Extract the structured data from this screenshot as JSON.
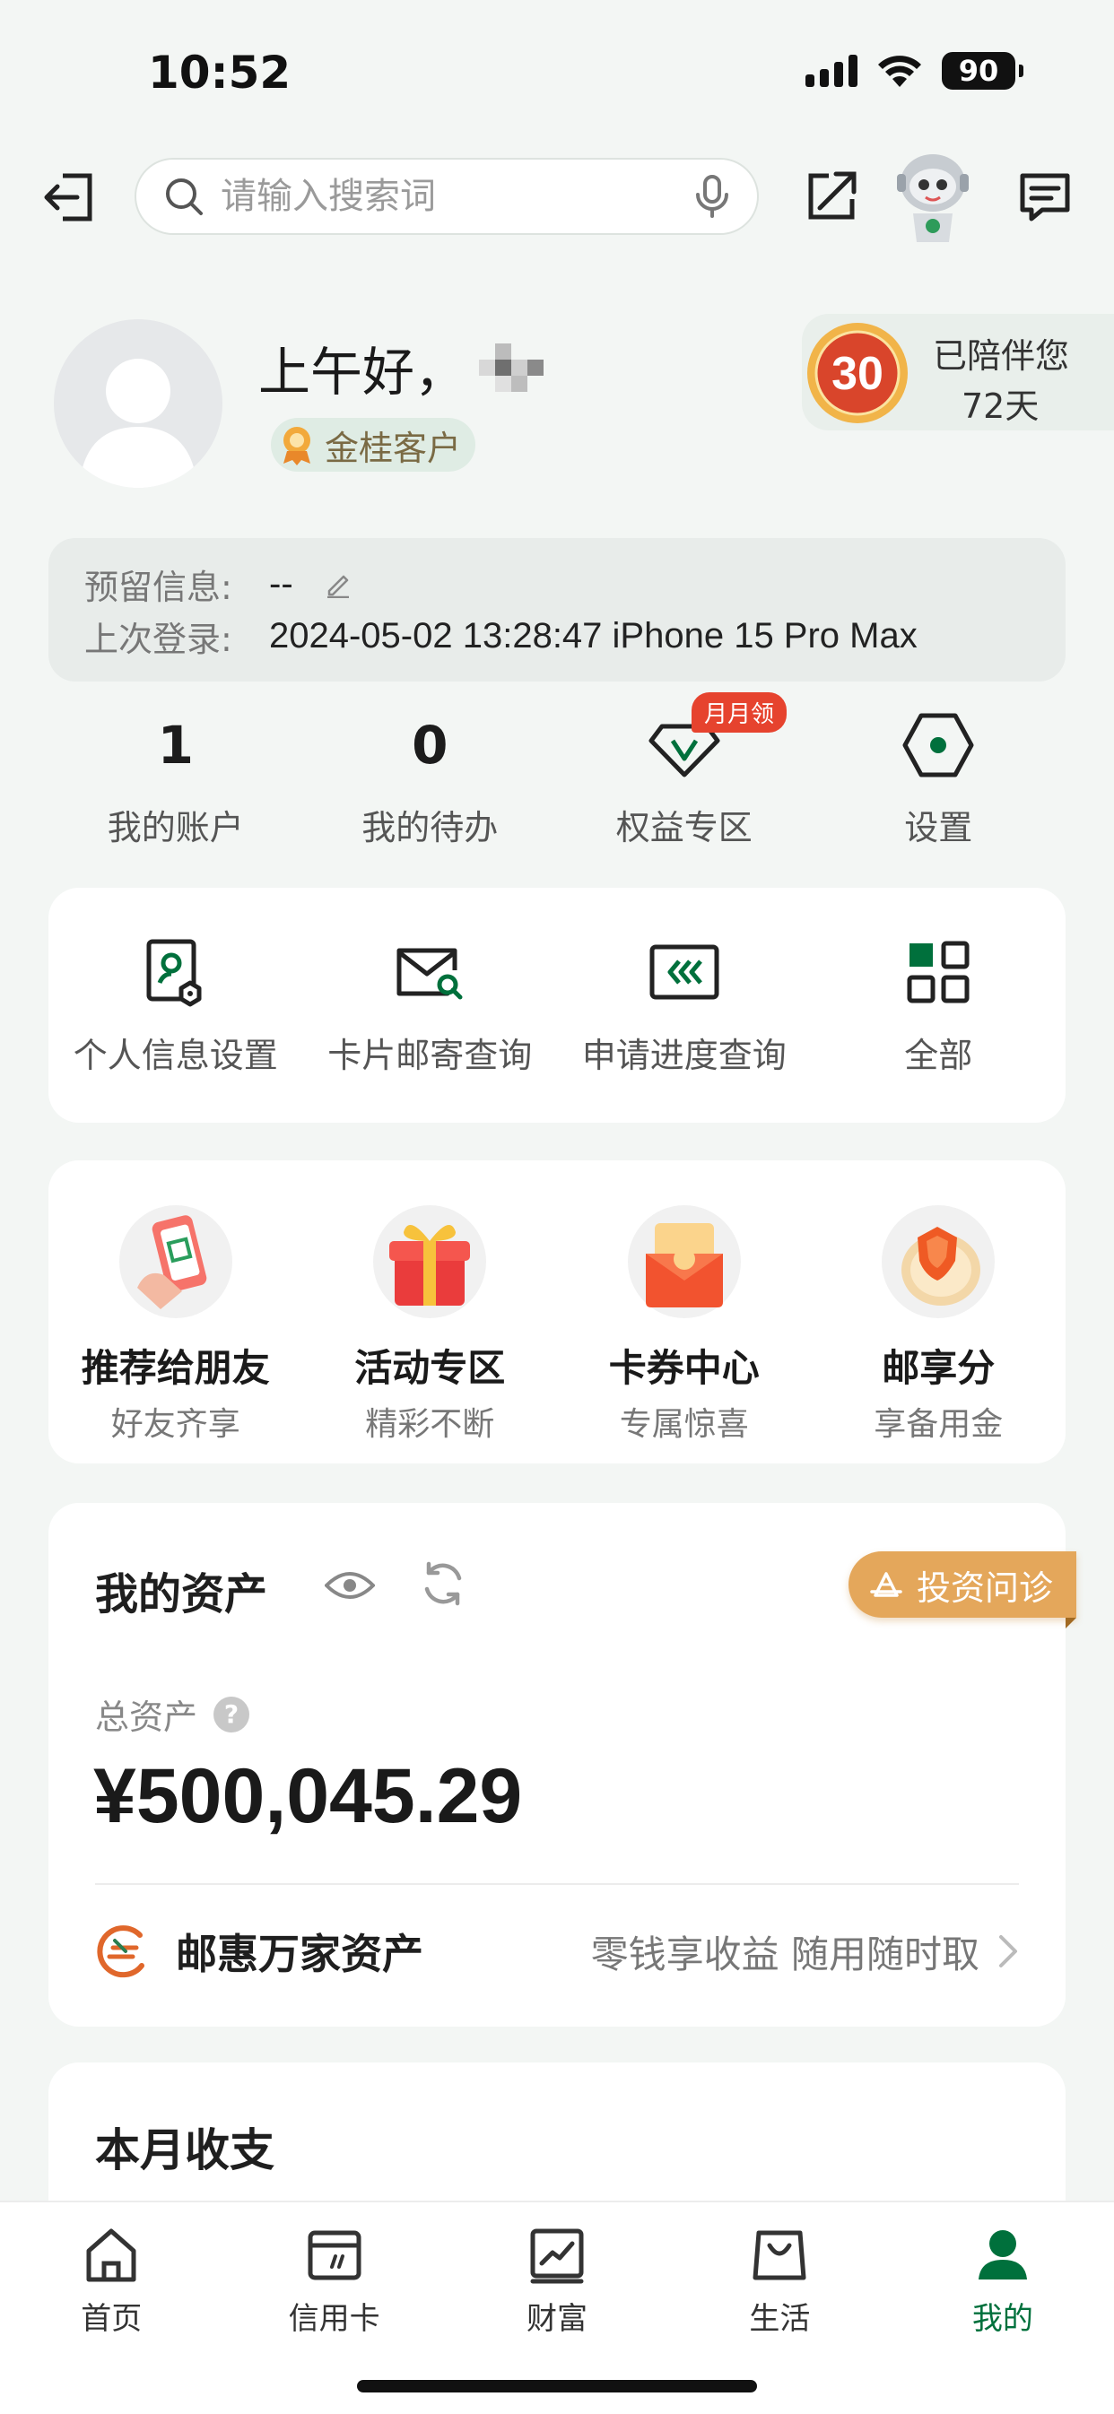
{
  "status_bar": {
    "time": "10:52",
    "battery": "90"
  },
  "search": {
    "placeholder": "请输入搜索词"
  },
  "profile": {
    "greeting": "上午好，",
    "tier": "金桂客户",
    "companion_badge": "30",
    "companion_title": "已陪伴您",
    "companion_days": "72天"
  },
  "info": {
    "reserved_label": "预留信息:",
    "reserved_value": "--",
    "last_login_label": "上次登录:",
    "last_login_value": "2024-05-02 13:28:47 iPhone 15 Pro Max"
  },
  "stats": {
    "accounts_count": "1",
    "accounts_label": "我的账户",
    "todo_count": "0",
    "todo_label": "我的待办",
    "rights_label": "权益专区",
    "rights_badge": "月月领",
    "settings_label": "设置"
  },
  "quick_actions": [
    {
      "label": "个人信息设置",
      "icon": "user-settings-icon"
    },
    {
      "label": "卡片邮寄查询",
      "icon": "mail-search-icon"
    },
    {
      "label": "申请进度查询",
      "icon": "progress-icon"
    },
    {
      "label": "全部",
      "icon": "grid-icon"
    }
  ],
  "promos": [
    {
      "title": "推荐给朋友",
      "subtitle": "好友齐享",
      "icon": "phone-qr-icon"
    },
    {
      "title": "活动专区",
      "subtitle": "精彩不断",
      "icon": "gift-box-icon"
    },
    {
      "title": "卡券中心",
      "subtitle": "专属惊喜",
      "icon": "coupon-envelope-icon"
    },
    {
      "title": "邮享分",
      "subtitle": "享备用金",
      "icon": "shield-coin-icon"
    }
  ],
  "assets": {
    "title": "我的资产",
    "invest_button": "投资问诊",
    "total_label": "总资产",
    "total_value": "¥500,045.29",
    "product_name": "邮惠万家资产",
    "product_desc": "零钱享收益 随用随时取"
  },
  "month": {
    "title": "本月收支"
  },
  "tabs": [
    {
      "label": "首页",
      "icon": "home-icon"
    },
    {
      "label": "信用卡",
      "icon": "credit-card-icon"
    },
    {
      "label": "财富",
      "icon": "wealth-chart-icon"
    },
    {
      "label": "生活",
      "icon": "shopping-bag-icon"
    },
    {
      "label": "我的",
      "icon": "user-icon",
      "active": true
    }
  ],
  "colors": {
    "brand_green": "#00703c",
    "badge_red": "#e6432e",
    "invest_gold": "#e4a75b",
    "background": "#f3f6f4"
  }
}
